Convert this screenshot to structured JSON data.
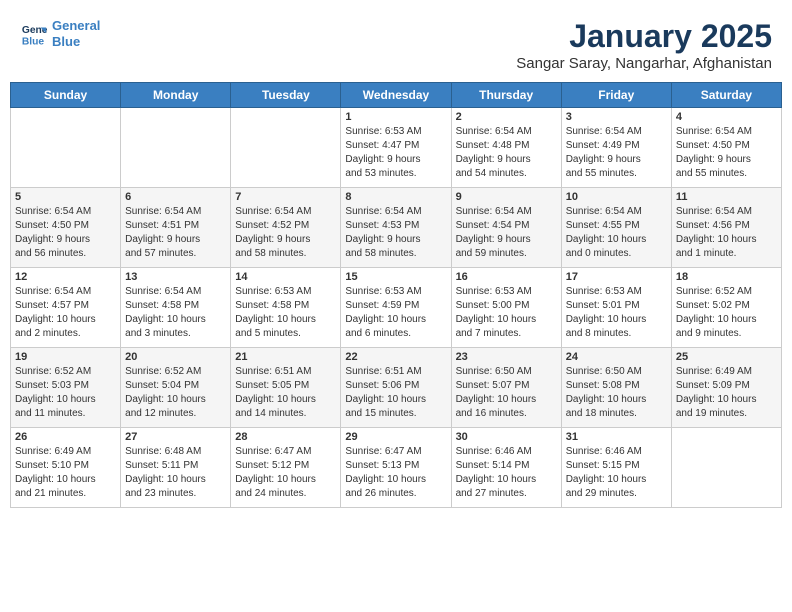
{
  "logo": {
    "line1": "General",
    "line2": "Blue"
  },
  "title": "January 2025",
  "subtitle": "Sangar Saray, Nangarhar, Afghanistan",
  "days_of_week": [
    "Sunday",
    "Monday",
    "Tuesday",
    "Wednesday",
    "Thursday",
    "Friday",
    "Saturday"
  ],
  "weeks": [
    [
      {
        "day": "",
        "info": ""
      },
      {
        "day": "",
        "info": ""
      },
      {
        "day": "",
        "info": ""
      },
      {
        "day": "1",
        "info": "Sunrise: 6:53 AM\nSunset: 4:47 PM\nDaylight: 9 hours\nand 53 minutes."
      },
      {
        "day": "2",
        "info": "Sunrise: 6:54 AM\nSunset: 4:48 PM\nDaylight: 9 hours\nand 54 minutes."
      },
      {
        "day": "3",
        "info": "Sunrise: 6:54 AM\nSunset: 4:49 PM\nDaylight: 9 hours\nand 55 minutes."
      },
      {
        "day": "4",
        "info": "Sunrise: 6:54 AM\nSunset: 4:50 PM\nDaylight: 9 hours\nand 55 minutes."
      }
    ],
    [
      {
        "day": "5",
        "info": "Sunrise: 6:54 AM\nSunset: 4:50 PM\nDaylight: 9 hours\nand 56 minutes."
      },
      {
        "day": "6",
        "info": "Sunrise: 6:54 AM\nSunset: 4:51 PM\nDaylight: 9 hours\nand 57 minutes."
      },
      {
        "day": "7",
        "info": "Sunrise: 6:54 AM\nSunset: 4:52 PM\nDaylight: 9 hours\nand 58 minutes."
      },
      {
        "day": "8",
        "info": "Sunrise: 6:54 AM\nSunset: 4:53 PM\nDaylight: 9 hours\nand 58 minutes."
      },
      {
        "day": "9",
        "info": "Sunrise: 6:54 AM\nSunset: 4:54 PM\nDaylight: 9 hours\nand 59 minutes."
      },
      {
        "day": "10",
        "info": "Sunrise: 6:54 AM\nSunset: 4:55 PM\nDaylight: 10 hours\nand 0 minutes."
      },
      {
        "day": "11",
        "info": "Sunrise: 6:54 AM\nSunset: 4:56 PM\nDaylight: 10 hours\nand 1 minute."
      }
    ],
    [
      {
        "day": "12",
        "info": "Sunrise: 6:54 AM\nSunset: 4:57 PM\nDaylight: 10 hours\nand 2 minutes."
      },
      {
        "day": "13",
        "info": "Sunrise: 6:54 AM\nSunset: 4:58 PM\nDaylight: 10 hours\nand 3 minutes."
      },
      {
        "day": "14",
        "info": "Sunrise: 6:53 AM\nSunset: 4:58 PM\nDaylight: 10 hours\nand 5 minutes."
      },
      {
        "day": "15",
        "info": "Sunrise: 6:53 AM\nSunset: 4:59 PM\nDaylight: 10 hours\nand 6 minutes."
      },
      {
        "day": "16",
        "info": "Sunrise: 6:53 AM\nSunset: 5:00 PM\nDaylight: 10 hours\nand 7 minutes."
      },
      {
        "day": "17",
        "info": "Sunrise: 6:53 AM\nSunset: 5:01 PM\nDaylight: 10 hours\nand 8 minutes."
      },
      {
        "day": "18",
        "info": "Sunrise: 6:52 AM\nSunset: 5:02 PM\nDaylight: 10 hours\nand 9 minutes."
      }
    ],
    [
      {
        "day": "19",
        "info": "Sunrise: 6:52 AM\nSunset: 5:03 PM\nDaylight: 10 hours\nand 11 minutes."
      },
      {
        "day": "20",
        "info": "Sunrise: 6:52 AM\nSunset: 5:04 PM\nDaylight: 10 hours\nand 12 minutes."
      },
      {
        "day": "21",
        "info": "Sunrise: 6:51 AM\nSunset: 5:05 PM\nDaylight: 10 hours\nand 14 minutes."
      },
      {
        "day": "22",
        "info": "Sunrise: 6:51 AM\nSunset: 5:06 PM\nDaylight: 10 hours\nand 15 minutes."
      },
      {
        "day": "23",
        "info": "Sunrise: 6:50 AM\nSunset: 5:07 PM\nDaylight: 10 hours\nand 16 minutes."
      },
      {
        "day": "24",
        "info": "Sunrise: 6:50 AM\nSunset: 5:08 PM\nDaylight: 10 hours\nand 18 minutes."
      },
      {
        "day": "25",
        "info": "Sunrise: 6:49 AM\nSunset: 5:09 PM\nDaylight: 10 hours\nand 19 minutes."
      }
    ],
    [
      {
        "day": "26",
        "info": "Sunrise: 6:49 AM\nSunset: 5:10 PM\nDaylight: 10 hours\nand 21 minutes."
      },
      {
        "day": "27",
        "info": "Sunrise: 6:48 AM\nSunset: 5:11 PM\nDaylight: 10 hours\nand 23 minutes."
      },
      {
        "day": "28",
        "info": "Sunrise: 6:47 AM\nSunset: 5:12 PM\nDaylight: 10 hours\nand 24 minutes."
      },
      {
        "day": "29",
        "info": "Sunrise: 6:47 AM\nSunset: 5:13 PM\nDaylight: 10 hours\nand 26 minutes."
      },
      {
        "day": "30",
        "info": "Sunrise: 6:46 AM\nSunset: 5:14 PM\nDaylight: 10 hours\nand 27 minutes."
      },
      {
        "day": "31",
        "info": "Sunrise: 6:46 AM\nSunset: 5:15 PM\nDaylight: 10 hours\nand 29 minutes."
      },
      {
        "day": "",
        "info": ""
      }
    ]
  ]
}
